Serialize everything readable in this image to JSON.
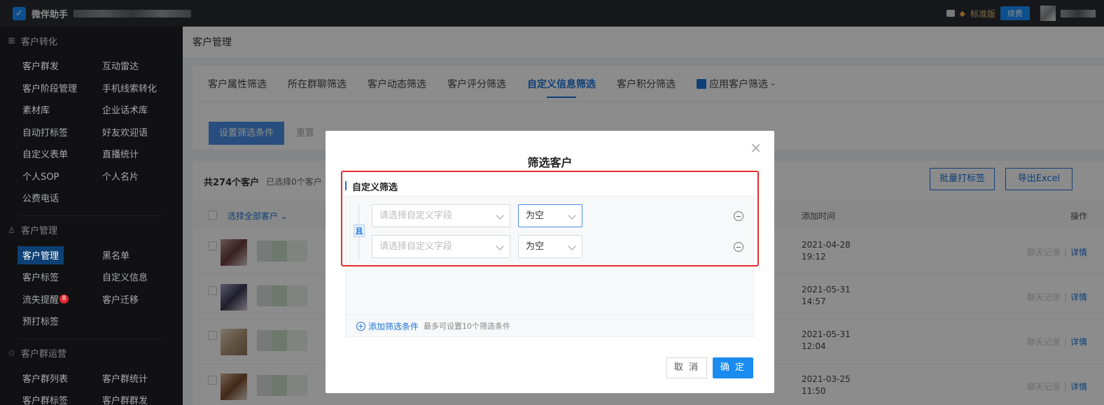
{
  "app": {
    "name": "微伴助手",
    "edition": "标准版",
    "renew": "续费"
  },
  "sidebar": {
    "sections": [
      {
        "title": "客户转化",
        "icon": "grid-icon",
        "items": [
          "客户群发",
          "互动雷达",
          "客户阶段管理",
          "手机线索转化",
          "素材库",
          "企业话术库",
          "自动打标签",
          "好友欢迎语",
          "自定义表单",
          "直播统计",
          "个人SOP",
          "个人名片",
          "公费电话"
        ]
      },
      {
        "title": "客户管理",
        "icon": "person-icon",
        "items": [
          "客户管理",
          "黑名单",
          "客户标签",
          "自定义信息",
          "流失提醒",
          "客户迁移",
          "预打标签"
        ],
        "badge": "8"
      },
      {
        "title": "客户群运营",
        "icon": "group-icon",
        "items": [
          "客户群列表",
          "客户群统计",
          "客户群标签",
          "客户群群发"
        ]
      }
    ]
  },
  "main": {
    "breadcrumb": "客户管理",
    "tabs": [
      "客户属性筛选",
      "所在群聊筛选",
      "客户动态筛选",
      "客户评分筛选",
      "自定义信息筛选",
      "客户积分筛选",
      "应用客户筛选"
    ],
    "active_tab": "自定义信息筛选",
    "set_filter": "设置筛选条件",
    "reset": "重置",
    "total": "共274个客户",
    "selected": "已选择0个客户",
    "batch_tag": "批量打标签",
    "export": "导出Excel",
    "columns": {
      "select_all": "选择全部客户",
      "added_time": "添加时间",
      "actions": "操作"
    },
    "rows": [
      {
        "date": "2021-04-28",
        "time": "19:12"
      },
      {
        "date": "2021-05-31",
        "time": "14:57"
      },
      {
        "date": "2021-05-31",
        "time": "12:04"
      },
      {
        "date": "2021-03-25",
        "time": "11:50"
      }
    ],
    "op_chat": "聊天记录",
    "op_sep": "|",
    "op_detail": "详情"
  },
  "modal": {
    "title": "筛选客户",
    "section": "自定义筛选",
    "and_label": "且",
    "conditions": [
      {
        "field_placeholder": "请选择自定义字段",
        "operator": "为空"
      },
      {
        "field_placeholder": "请选择自定义字段",
        "operator": "为空"
      }
    ],
    "add_condition": "添加筛选条件",
    "add_hint": "最多可设置10个筛选条件",
    "cancel": "取 消",
    "confirm": "确 定"
  }
}
